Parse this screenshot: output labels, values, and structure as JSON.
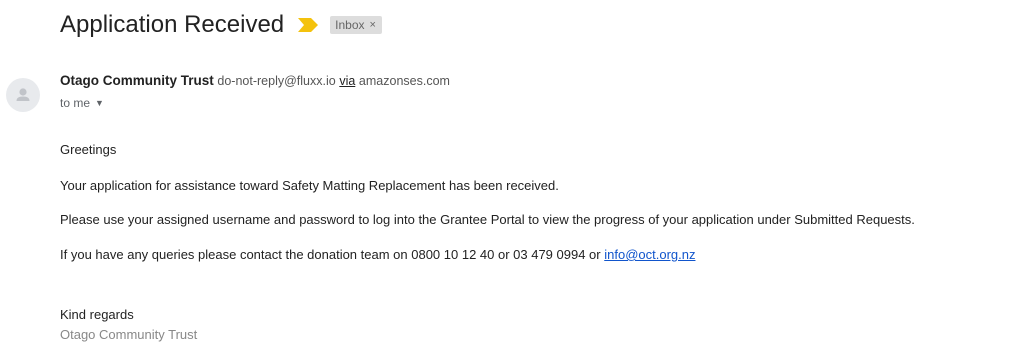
{
  "subject": "Application Received",
  "label_chip": {
    "label": "Inbox",
    "close_glyph": "×"
  },
  "importance_marker": {
    "icon": "importance-arrow-icon",
    "color": "#f4c20d"
  },
  "sender": {
    "name": "Otago Community Trust",
    "email": "do-not-reply@fluxx.io",
    "via_label": "via",
    "via_domain": "amazonses.com",
    "avatar_icon": "person-icon"
  },
  "recipient": {
    "text": "to me",
    "caret_glyph": "▼"
  },
  "body": {
    "greeting": "Greetings",
    "line1": "Your application for assistance toward Safety Matting Replacement  has been received.",
    "line2": "Please use your assigned username and password to log into the Grantee Portal to view the progress of your application under Submitted Requests.",
    "line3_text": "If you have any queries please contact the donation team on 0800 10 12 40 or 03 479 0994 or ",
    "line3_link": "info@oct.org.nz",
    "closing": "Kind regards",
    "signature": "Otago Community Trust"
  },
  "colors": {
    "link": "#1155cc",
    "chip_background": "#dddddd",
    "signature_gray": "#888888"
  }
}
